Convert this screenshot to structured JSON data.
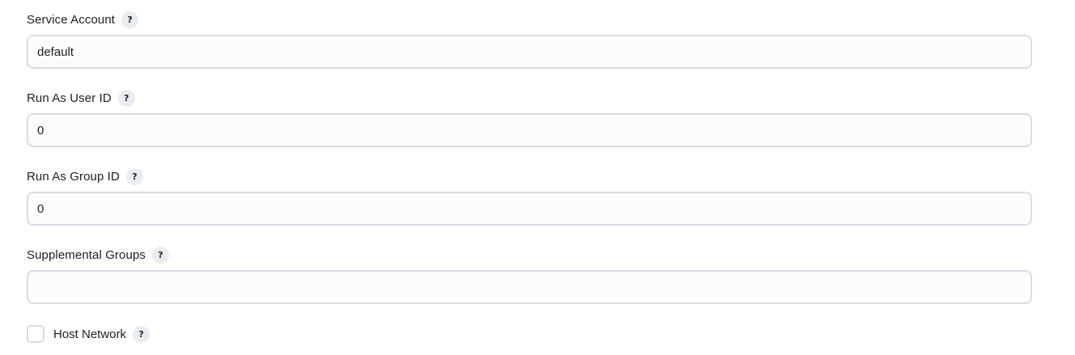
{
  "fields": [
    {
      "label": "Service Account",
      "value": "default",
      "placeholder": ""
    },
    {
      "label": "Run As User ID",
      "value": "0",
      "placeholder": ""
    },
    {
      "label": "Run As Group ID",
      "value": "0",
      "placeholder": ""
    },
    {
      "label": "Supplemental Groups",
      "value": "",
      "placeholder": ""
    }
  ],
  "host_network": {
    "label": "Host Network",
    "checked": false
  },
  "help_symbol": "?"
}
